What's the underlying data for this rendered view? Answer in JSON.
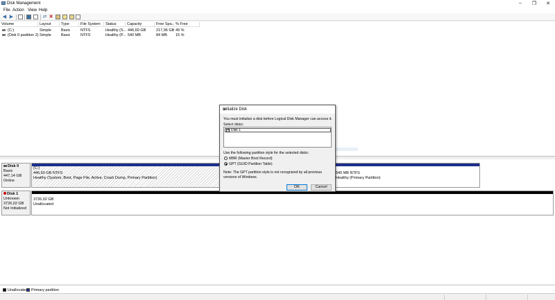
{
  "window": {
    "title": "Disk Management",
    "controls": [
      "–",
      "❐",
      "✕"
    ]
  },
  "menu": [
    "File",
    "Action",
    "View",
    "Help"
  ],
  "toolbar": {
    "icons": [
      "back-icon",
      "forward-icon",
      "list-icon",
      "help-icon",
      "properties-icon",
      "connect-icon",
      "delete-icon",
      "folder-icon",
      "open-icon",
      "settings-icon"
    ]
  },
  "table": {
    "headers": [
      "Volume",
      "Layout",
      "Type",
      "File System",
      "Status",
      "Capacity",
      "Free Spa...",
      "% Free"
    ],
    "rows": [
      [
        "(C:)",
        "Simple",
        "Basic",
        "NTFS",
        "Healthy (S...",
        "446,60 GB",
        "217,96 GB",
        "49 %"
      ],
      [
        "(Disk 0 partition 2)",
        "Simple",
        "Basic",
        "NTFS",
        "Healthy (P...",
        "540 MB",
        "84 MB",
        "15 %"
      ]
    ]
  },
  "disks": {
    "disk0": {
      "name": "Disk 0",
      "type": "Basic",
      "size": "447,14 GB",
      "state": "Online",
      "part1": {
        "label": "(C:)",
        "size": "446,60 GB NTFS",
        "status": "Healthy (System, Boot, Page File, Active, Crash Dump, Primary Partition)"
      },
      "part2": {
        "size": "540 MB NTFS",
        "status": "Healthy (Primary Partition)"
      }
    },
    "disk1": {
      "name": "Disk 1",
      "type": "Unknown",
      "size": "3726,02 GB",
      "state": "Not Initialized",
      "part1": {
        "size": "3726,02 GB",
        "status": "Unallocated"
      }
    }
  },
  "legend": {
    "unallocated": "Unallocated",
    "primary": "Primary partition",
    "colors": {
      "unallocated": "#000000",
      "primary": "#1e2f8a"
    }
  },
  "dialog": {
    "title": "Initialize Disk",
    "close": "✕",
    "message": "You must initialize a disk before Logical Disk Manager can access it.",
    "select_label": "Select disks:",
    "disk_item": "Disk 1",
    "style_label": "Use the following partition style for the selected disks:",
    "mbr": "MBR (Master Boot Record)",
    "gpt": "GPT (GUID Partition Table)",
    "note": "Note: The GPT partition style is not recognized by all previous versions of Windows.",
    "ok": "OK",
    "cancel": "Cancel"
  }
}
